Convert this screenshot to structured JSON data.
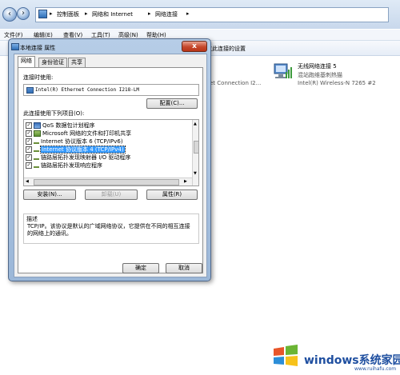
{
  "explorer": {
    "breadcrumb": [
      "控制面板",
      "网络和 Internet",
      "网络连接"
    ],
    "menu": [
      "文件(F)",
      "编辑(E)",
      "查看(V)",
      "工具(T)",
      "高级(N)",
      "帮助(H)"
    ],
    "command_text": "改此连接的设置",
    "partial_adapter_text": "et Connection I2...",
    "wifi": {
      "name": "无线网络连接 5",
      "status": "混站跑维基刺热猫",
      "device": "Intel(R) Wireless-N 7265 #2"
    }
  },
  "dialog": {
    "title": "本地连接 属性",
    "close_label": "x",
    "tabs": [
      "网络",
      "身份验证",
      "共享"
    ],
    "connect_using_label": "连接时使用:",
    "adapter_name": "Intel(R) Ethernet Connection I218-LM",
    "configure_button": "配置(C)...",
    "items_label": "此连接使用下列项目(O):",
    "items": [
      {
        "label": "QoS 数据包计划程序",
        "checked": true,
        "icon": "network-icon"
      },
      {
        "label": "Microsoft 网络的文件和打印机共享",
        "checked": true,
        "icon": "share-icon"
      },
      {
        "label": "Internet 协议版本 6 (TCP/IPv6)",
        "checked": true,
        "icon": "protocol-icon"
      },
      {
        "label": "Internet 协议版本 4 (TCP/IPv4)",
        "checked": true,
        "icon": "protocol-icon",
        "selected": true
      },
      {
        "label": "链路层拓扑发现映射器 I/O 驱动程序",
        "checked": true,
        "icon": "protocol-icon"
      },
      {
        "label": "链路层拓扑发现响应程序",
        "checked": true,
        "icon": "protocol-icon"
      }
    ],
    "install_button": "安装(N)...",
    "uninstall_button": "卸载(U)",
    "properties_button": "属性(R)",
    "description_label": "描述",
    "description_text": "TCP/IP。该协议是默认的广域网络协议，它提供在不同的相互连接的网络上的通讯。",
    "ok_button": "确定",
    "cancel_button": "取消"
  },
  "watermark": {
    "text": "windows系统家园",
    "site": "www.ruihafu.com"
  }
}
